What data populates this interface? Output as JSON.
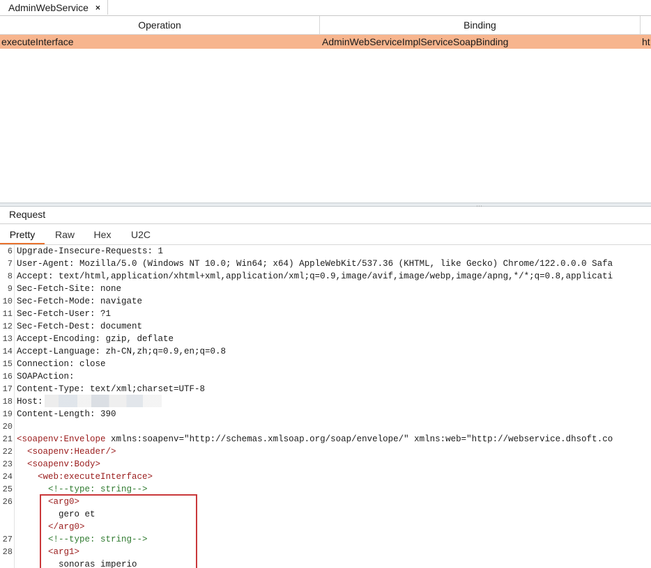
{
  "tab": {
    "label": "AdminWebService",
    "close": "×"
  },
  "table": {
    "headers": [
      "Operation",
      "Binding"
    ],
    "rows": [
      {
        "operation": "executeInterface",
        "binding": "AdminWebServiceImplServiceSoapBinding",
        "extra": "ht"
      }
    ]
  },
  "request": {
    "title": "Request",
    "tabs": [
      "Pretty",
      "Raw",
      "Hex",
      "U2C"
    ],
    "active_tab": "Pretty"
  },
  "code_lines": [
    {
      "ln": "6",
      "text": "Upgrade-Insecure-Requests: 1"
    },
    {
      "ln": "7",
      "text": "User-Agent: Mozilla/5.0 (Windows NT 10.0; Win64; x64) AppleWebKit/537.36 (KHTML, like Gecko) Chrome/122.0.0.0 Safa"
    },
    {
      "ln": "8",
      "text": "Accept: text/html,application/xhtml+xml,application/xml;q=0.9,image/avif,image/webp,image/apng,*/*;q=0.8,applicati"
    },
    {
      "ln": "9",
      "text": "Sec-Fetch-Site: none"
    },
    {
      "ln": "10",
      "text": "Sec-Fetch-Mode: navigate"
    },
    {
      "ln": "11",
      "text": "Sec-Fetch-User: ?1"
    },
    {
      "ln": "12",
      "text": "Sec-Fetch-Dest: document"
    },
    {
      "ln": "13",
      "text": "Accept-Encoding: gzip, deflate"
    },
    {
      "ln": "14",
      "text": "Accept-Language: zh-CN,zh;q=0.9,en;q=0.8"
    },
    {
      "ln": "15",
      "text": "Connection: close"
    },
    {
      "ln": "16",
      "text": "SOAPAction:"
    },
    {
      "ln": "17",
      "text": "Content-Type: text/xml;charset=UTF-8"
    },
    {
      "ln": "18",
      "text": "Host:"
    },
    {
      "ln": "19",
      "text": "Content-Length: 390"
    },
    {
      "ln": "20",
      "text": ""
    },
    {
      "ln": "21",
      "text": "<soapenv:Envelope xmlns:soapenv=\"http://schemas.xmlsoap.org/soap/envelope/\" xmlns:web=\"http://webservice.dhsoft.co"
    },
    {
      "ln": "22",
      "text": "  <soapenv:Header/>"
    },
    {
      "ln": "23",
      "text": "  <soapenv:Body>"
    },
    {
      "ln": "24",
      "text": "    <web:executeInterface>"
    },
    {
      "ln": "25",
      "text": "      <!--type: string-->"
    },
    {
      "ln": "26",
      "text": "      <arg0>"
    },
    {
      "ln": "",
      "text": "        gero et"
    },
    {
      "ln": "",
      "text": "      </arg0>"
    },
    {
      "ln": "27",
      "text": "      <!--type: string-->"
    },
    {
      "ln": "28",
      "text": "      <arg1>"
    },
    {
      "ln": "",
      "text": "        sonoras imperio"
    }
  ],
  "colors": {
    "selected_row": "#f7b58e",
    "active_tab_underline": "#e8722e",
    "highlight_box": "#c9383a",
    "xml_tag": "#9a1c1c",
    "xml_comment": "#2f7a2f"
  }
}
